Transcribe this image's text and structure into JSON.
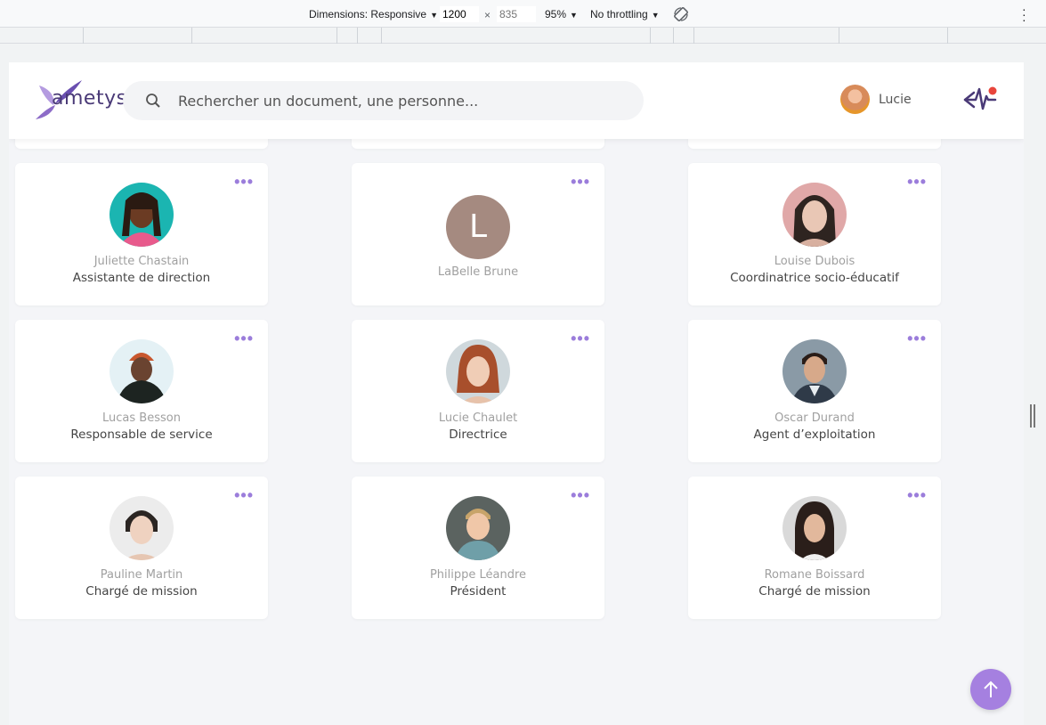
{
  "devtools": {
    "dimensions_label": "Dimensions: Responsive",
    "width": "1200",
    "height_placeholder": "835",
    "times": "×",
    "zoom": "95%",
    "throttling": "No throttling"
  },
  "header": {
    "logo_text": "ametys",
    "search_placeholder": "Rechercher un document, une personne...",
    "user_name": "Lucie"
  },
  "colors": {
    "accent": "#a580e0",
    "more_dots": "#9b7ddb",
    "logo": "#4a3a77",
    "notification": "#e8453c"
  },
  "people": [
    {
      "name": "Juliette Chastain",
      "role": "Assistante de direction",
      "photo": "juliette-photo"
    },
    {
      "name": "LaBelle Brune",
      "role": "",
      "initial": "L"
    },
    {
      "name": "Louise Dubois",
      "role": "Coordinatrice socio-éducatif",
      "photo": "louise-photo"
    },
    {
      "name": "Lucas Besson",
      "role": "Responsable de service",
      "photo": "lucas-photo"
    },
    {
      "name": "Lucie Chaulet",
      "role": "Directrice",
      "photo": "lucie-photo"
    },
    {
      "name": "Oscar Durand",
      "role": "Agent d’exploitation",
      "photo": "oscar-photo"
    },
    {
      "name": "Pauline Martin",
      "role": "Chargé de mission",
      "photo": "pauline-photo"
    },
    {
      "name": "Philippe Léandre",
      "role": "Président",
      "photo": "philippe-photo"
    },
    {
      "name": "Romane Boissard",
      "role": "Chargé de mission",
      "photo": "romane-photo"
    }
  ],
  "more_label": "•••"
}
